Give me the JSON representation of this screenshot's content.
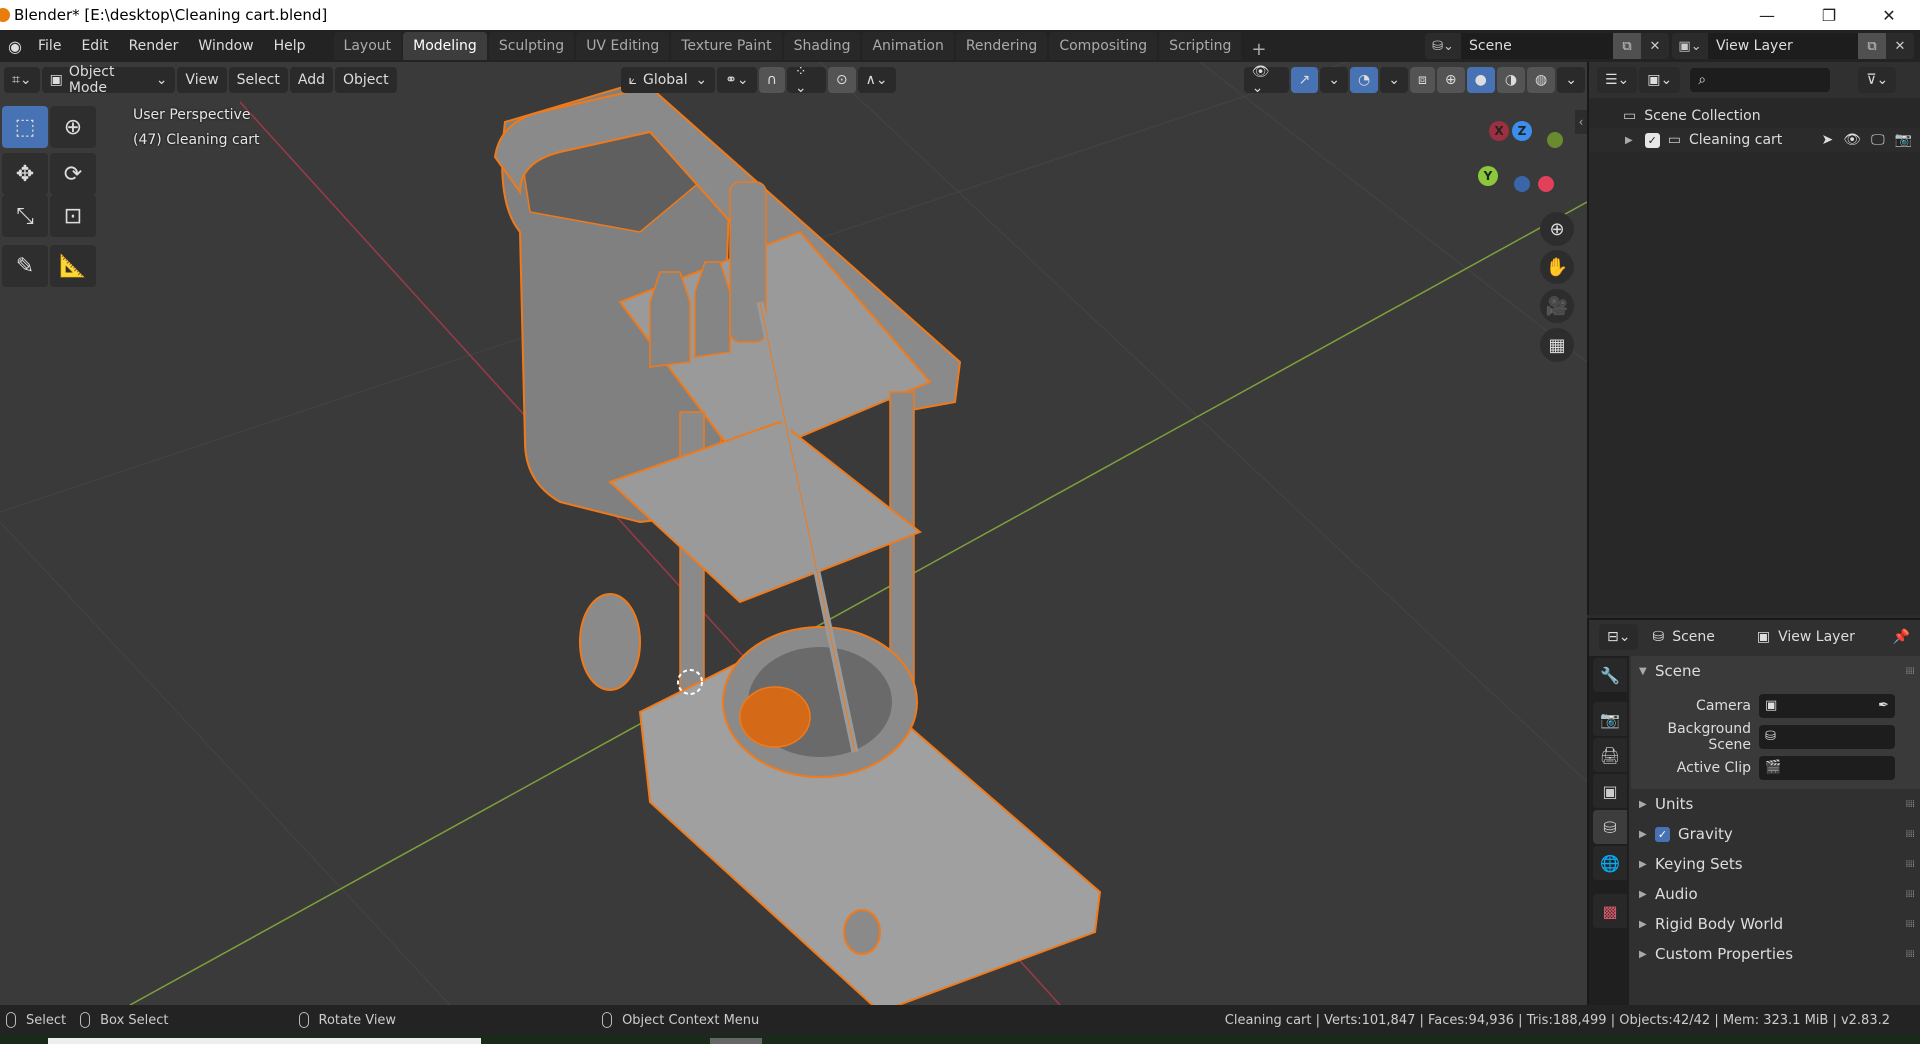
{
  "window": {
    "title": "Blender* [E:\\desktop\\Cleaning cart.blend]",
    "controls": {
      "minimize": "—",
      "maximize": "❐",
      "close": "✕"
    }
  },
  "menubar": {
    "items": [
      "File",
      "Edit",
      "Render",
      "Window",
      "Help"
    ],
    "workspaces": [
      "Layout",
      "Modeling",
      "Sculpting",
      "UV Editing",
      "Texture Paint",
      "Shading",
      "Animation",
      "Rendering",
      "Compositing",
      "Scripting"
    ],
    "active_workspace": "Modeling",
    "add_workspace": "+",
    "scene_name": "Scene",
    "view_layer_name": "View Layer"
  },
  "viewport_header": {
    "mode": "Object Mode",
    "menus": [
      "View",
      "Select",
      "Add",
      "Object"
    ],
    "transform_orientation": "Global"
  },
  "viewport": {
    "view_name": "User Perspective",
    "object_info": "(47) Cleaning cart",
    "gizmo_axes": {
      "x": "X",
      "y": "Y",
      "z": "Z"
    },
    "colors": {
      "x_axis": "#c9384a",
      "y_axis": "#8bc83c",
      "z_axis": "#3b8eea",
      "selection_outline": "#f07a1a",
      "background": "#3a3a3a",
      "model": "#8c8c8c"
    }
  },
  "outliner": {
    "root": "Scene Collection",
    "items": [
      {
        "name": "Cleaning cart",
        "checked": true
      }
    ]
  },
  "properties": {
    "header": {
      "scene": "Scene",
      "view_layer": "View Layer"
    },
    "panel_title": "Scene",
    "fields": [
      {
        "label": "Camera",
        "value": ""
      },
      {
        "label": "Background Scene",
        "value": ""
      },
      {
        "label": "Active Clip",
        "value": ""
      }
    ],
    "subpanels": [
      {
        "label": "Units",
        "checkbox": false
      },
      {
        "label": "Gravity",
        "checkbox": true
      },
      {
        "label": "Keying Sets",
        "checkbox": false
      },
      {
        "label": "Audio",
        "checkbox": false
      },
      {
        "label": "Rigid Body World",
        "checkbox": false
      },
      {
        "label": "Custom Properties",
        "checkbox": false
      }
    ]
  },
  "statusbar": {
    "select": "Select",
    "box_select": "Box Select",
    "rotate_view": "Rotate View",
    "context_menu": "Object Context Menu",
    "stats": "Cleaning cart | Verts:101,847 | Faces:94,936 | Tris:188,499 | Objects:42/42 | Mem: 323.1 MiB | v2.83.2"
  }
}
